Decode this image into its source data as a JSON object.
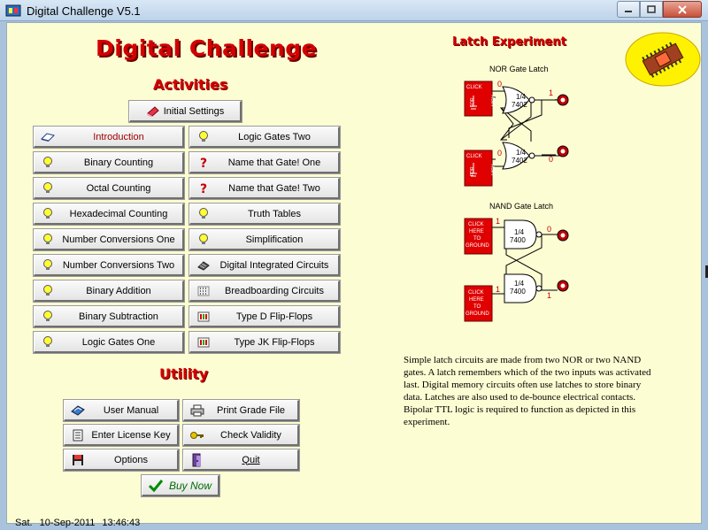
{
  "window": {
    "title": "Digital Challenge V5.1"
  },
  "header": {
    "app_title": "Digital Challenge",
    "activities_heading": "Activities",
    "utility_heading": "Utility",
    "experiment_heading": "Latch Experiment"
  },
  "settings_button": {
    "label": "Initial Settings",
    "icon": "eraser-icon"
  },
  "activities": {
    "left": [
      {
        "label": "Introduction",
        "icon": "book-icon"
      },
      {
        "label": "Binary Counting",
        "icon": "lightbulb-icon"
      },
      {
        "label": "Octal Counting",
        "icon": "lightbulb-icon"
      },
      {
        "label": "Hexadecimal Counting",
        "icon": "lightbulb-icon"
      },
      {
        "label": "Number Conversions One",
        "icon": "lightbulb-icon"
      },
      {
        "label": "Number Conversions Two",
        "icon": "lightbulb-icon"
      },
      {
        "label": "Binary Addition",
        "icon": "lightbulb-icon"
      },
      {
        "label": "Binary Subtraction",
        "icon": "lightbulb-icon"
      },
      {
        "label": "Logic Gates One",
        "icon": "lightbulb-icon"
      }
    ],
    "right": [
      {
        "label": "Logic Gates Two",
        "icon": "lightbulb-icon"
      },
      {
        "label": "Name that Gate! One",
        "icon": "question-icon"
      },
      {
        "label": "Name that Gate! Two",
        "icon": "question-icon"
      },
      {
        "label": "Truth Tables",
        "icon": "lightbulb-icon"
      },
      {
        "label": "Simplification",
        "icon": "lightbulb-icon"
      },
      {
        "label": "Digital Integrated Circuits",
        "icon": "chip-icon"
      },
      {
        "label": "Breadboarding Circuits",
        "icon": "breadboard-icon"
      },
      {
        "label": "Type D Flip-Flops",
        "icon": "flipflop-icon"
      },
      {
        "label": "Type JK Flip-Flops",
        "icon": "flipflop-icon"
      }
    ]
  },
  "utility": {
    "user_manual": "User Manual",
    "print_grade_file": "Print Grade File",
    "enter_license_key": "Enter License Key",
    "check_validity": "Check Validity",
    "options": "Options",
    "quit": "Quit",
    "buy_now": "Buy Now"
  },
  "circuit": {
    "nor_title": "NOR Gate Latch",
    "nand_title": "NAND Gate Latch",
    "nor_gate_label_1": "1/4",
    "nor_gate_label_2": "7402",
    "nand_gate_label_1": "1/4",
    "nand_gate_label_2": "7400",
    "nor_top_input": "0",
    "nor_top_output": "1",
    "nor_bottom_input": "0",
    "nor_bottom_output": "0",
    "nand_top_input": "1",
    "nand_top_output": "0",
    "nand_bottom_input": "1",
    "nand_bottom_output": "1",
    "nor_switch_text_1": "CLICK",
    "nor_switch_text_2": "FOR",
    "nor_switch_text_3": "HIGH",
    "nand_switch_text_1": "CLICK",
    "nand_switch_text_2": "HERE",
    "nand_switch_text_3": "TO",
    "nand_switch_text_4": "GROUND"
  },
  "description": "Simple latch circuits are made from two NOR or two NAND gates. A latch remembers which of the two inputs was activated last. Digital memory circuits often use latches to store binary data. Latches are also used to de-bounce electrical contacts. Bipolar TTL logic is required to function as depicted in this experiment.",
  "status_bar": {
    "day": "Sat.",
    "date": "10-Sep-2011",
    "time": "13:46:43"
  },
  "colors": {
    "title_red": "#d40000",
    "panel_bg": "#fdfdd3",
    "switch_red": "#e00000",
    "buy_green": "#006d00"
  }
}
